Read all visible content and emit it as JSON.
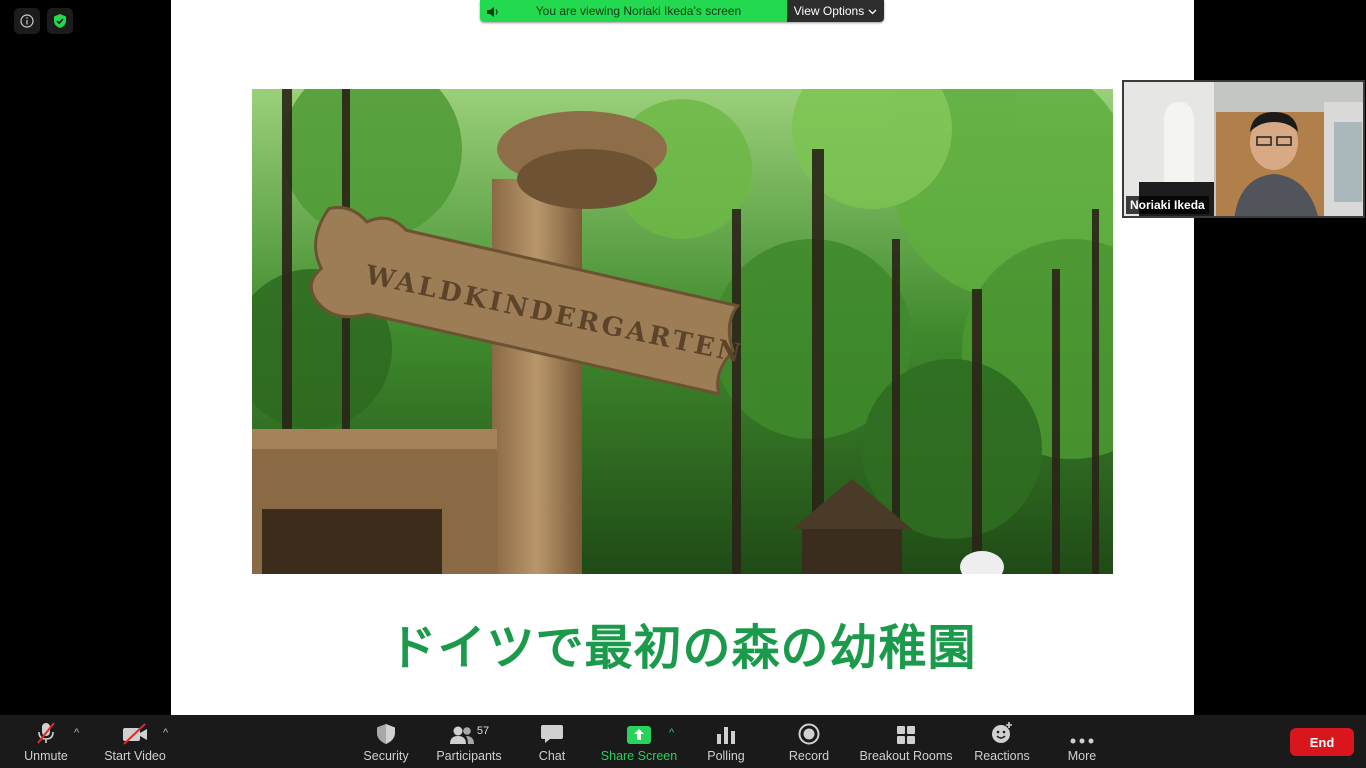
{
  "banner": {
    "message": "You are viewing Noriaki Ikeda’s screen",
    "view_options": "View Options"
  },
  "slide": {
    "sign_text": "WALDKINDERGARTEN",
    "caption": "ドイツで最初の森の幼稚園"
  },
  "participant": {
    "name": "Noriaki Ikeda"
  },
  "toolbar": {
    "unmute": "Unmute",
    "start_video": "Start Video",
    "security": "Security",
    "participants": "Participants",
    "participants_count": "57",
    "chat": "Chat",
    "share_screen": "Share Screen",
    "polling": "Polling",
    "record": "Record",
    "breakout_rooms": "Breakout Rooms",
    "reactions": "Reactions",
    "more": "More",
    "end": "End"
  },
  "colors": {
    "share_green": "#27d35a",
    "banner_green": "#23d94f",
    "end_red": "#d8161b",
    "caption_green": "#1a9a4a"
  }
}
